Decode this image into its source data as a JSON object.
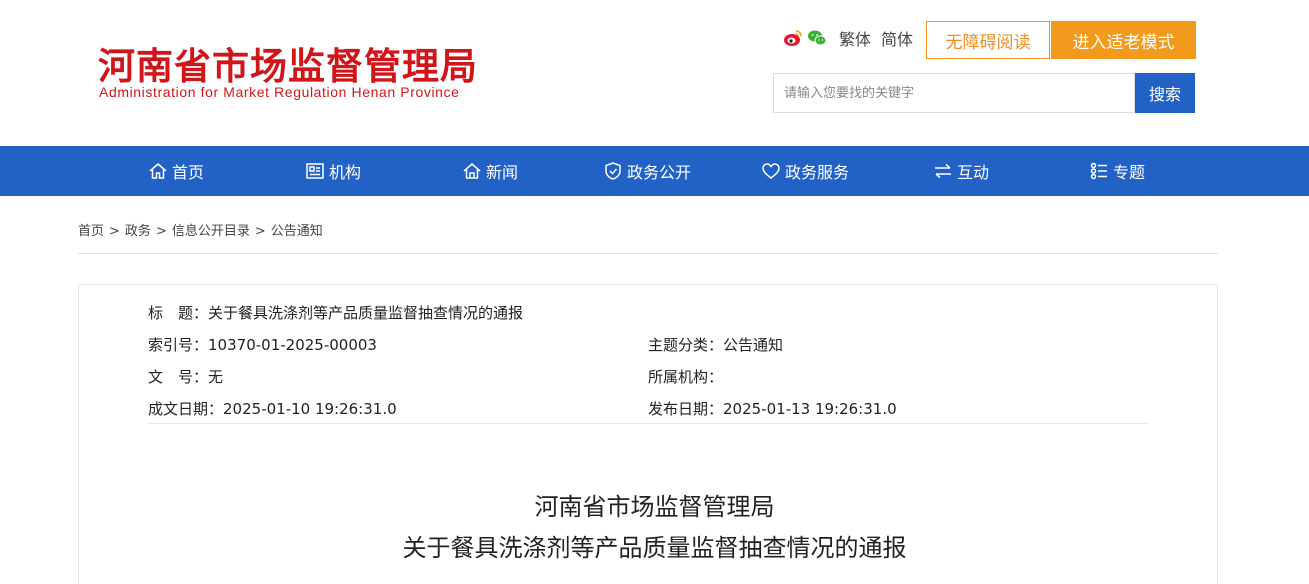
{
  "header": {
    "logo_cn": "河南省市场监督管理局",
    "logo_en": "Administration for Market Regulation Henan Province",
    "lang_traditional": "繁体",
    "lang_simplified": "简体",
    "accessible_reading": "无障碍阅读",
    "elder_mode": "进入适老模式",
    "search_placeholder": "请输入您要找的关键字",
    "search_button": "搜索",
    "colors": {
      "brand": "#d0161b",
      "accent": "#f29a1b",
      "nav": "#2262c6"
    }
  },
  "nav": {
    "items": [
      {
        "label": "首页",
        "icon": "home-icon"
      },
      {
        "label": "机构",
        "icon": "org-icon"
      },
      {
        "label": "新闻",
        "icon": "news-icon"
      },
      {
        "label": "政务公开",
        "icon": "shield-icon"
      },
      {
        "label": "政务服务",
        "icon": "heart-icon"
      },
      {
        "label": "互动",
        "icon": "exchange-icon"
      },
      {
        "label": "专题",
        "icon": "list-icon"
      }
    ]
  },
  "breadcrumb": [
    "首页",
    "政务",
    "信息公开目录",
    "公告通知"
  ],
  "meta": {
    "title_label": "标　题：",
    "title_value": "关于餐具洗涤剂等产品质量监督抽查情况的通报",
    "index_label": "索引号：",
    "index_value": "10370-01-2025-00003",
    "category_label": "主题分类：",
    "category_value": "公告通知",
    "doc_no_label": "文　号：",
    "doc_no_value": "无",
    "org_label": "所属机构：",
    "org_value": "",
    "created_label": "成文日期：",
    "created_value": "2025-01-10 19:26:31.0",
    "published_label": "发布日期：",
    "published_value": "2025-01-13 19:26:31.0"
  },
  "article": {
    "title_line1": "河南省市场监督管理局",
    "title_line2": "关于餐具洗涤剂等产品质量监督抽查情况的通报"
  }
}
